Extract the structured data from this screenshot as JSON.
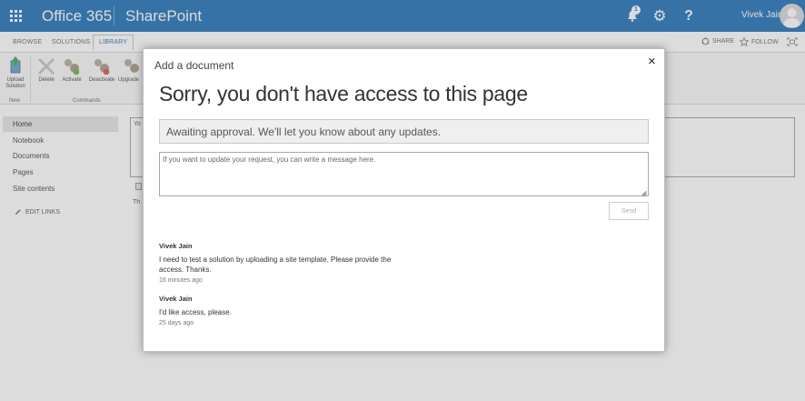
{
  "suite_bar": {
    "app_name": "Office 365",
    "site_name": "SharePoint",
    "notification_count": "1",
    "help_label": "?",
    "user_name": "Vivek Jain"
  },
  "ribbon": {
    "tabs": [
      "BROWSE",
      "SOLUTIONS",
      "LIBRARY"
    ],
    "selected_tab": "LIBRARY",
    "share_label": "SHARE",
    "follow_label": "FOLLOW",
    "buttons": {
      "upload": "Upload\nSolution",
      "delete": "Delete",
      "activate": "Activate",
      "deactivate": "Deactivate",
      "upgrade": "Upgrade"
    },
    "groups": [
      "New",
      "Commands"
    ]
  },
  "left_nav": {
    "items": [
      "Home",
      "Notebook",
      "Documents",
      "Pages",
      "Site contents"
    ],
    "selected": "Home",
    "edit_links": "EDIT LINKS"
  },
  "background_page": {
    "box_text": "Yo",
    "below_text": "Th"
  },
  "dialog": {
    "title": "Add a document",
    "close_glyph": "×",
    "heading": "Sorry, you don't have access to this page",
    "status": "Awaiting approval. We'll let you know about any updates.",
    "message_placeholder": "If you want to update your request, you can write a message here.",
    "send_label": "Send",
    "comments": [
      {
        "author": "Vivek Jain",
        "text": "I need to test a solution by uploading a site template. Please provide the access. Thanks.",
        "time": "16 minutes ago"
      },
      {
        "author": "Vivek Jain",
        "text": "I'd like access, please.",
        "time": "25 days ago"
      }
    ]
  }
}
